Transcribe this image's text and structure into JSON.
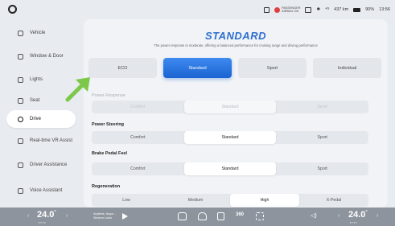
{
  "status_bar": {
    "airbag_line1": "PASSENGER",
    "airbag_line2": "AIRBAG ON",
    "signal": "⁴ᴳ",
    "range": "437 km",
    "battery": "90%",
    "time": "13:56"
  },
  "sidebar": {
    "items": [
      {
        "label": "Vehicle"
      },
      {
        "label": "Window & Door"
      },
      {
        "label": "Lights"
      },
      {
        "label": "Seat"
      },
      {
        "label": "Drive"
      },
      {
        "label": "Real-time VR Assist"
      },
      {
        "label": "Driver Assistance"
      },
      {
        "label": "Voice Assistant"
      }
    ]
  },
  "main": {
    "mode_title": "STANDARD",
    "mode_desc": "The power response is moderate, offering a balanced performance for cruising range and driving performance",
    "presets": [
      "ECO",
      "Standard",
      "Sport",
      "Individual"
    ],
    "selected_preset": "Standard",
    "power_response": {
      "label": "Power Response",
      "options": [
        "Comfort",
        "Standard",
        "Sport"
      ],
      "selected": "Standard"
    },
    "power_steering": {
      "label": "Power Steering",
      "options": [
        "Comfort",
        "Standard",
        "Sport"
      ],
      "selected": "Standard"
    },
    "brake_pedal": {
      "label": "Brake Pedal Feel",
      "options": [
        "Comfort",
        "Standard",
        "Sport"
      ],
      "selected": "Standard"
    },
    "regeneration": {
      "label": "Regeneration",
      "options": [
        "Low",
        "Medium",
        "High",
        "X-Pedal"
      ],
      "selected": "High"
    }
  },
  "dock": {
    "temp_left": "24.0",
    "temp_right": "24.0",
    "degree": "°",
    "media_title": "Anytime, Anyw...",
    "media_sub": "Simeon Loolo",
    "ac360": "360",
    "chev_left": "‹",
    "chev_right": "›",
    "temp_dots": "▪▪▪▪"
  }
}
